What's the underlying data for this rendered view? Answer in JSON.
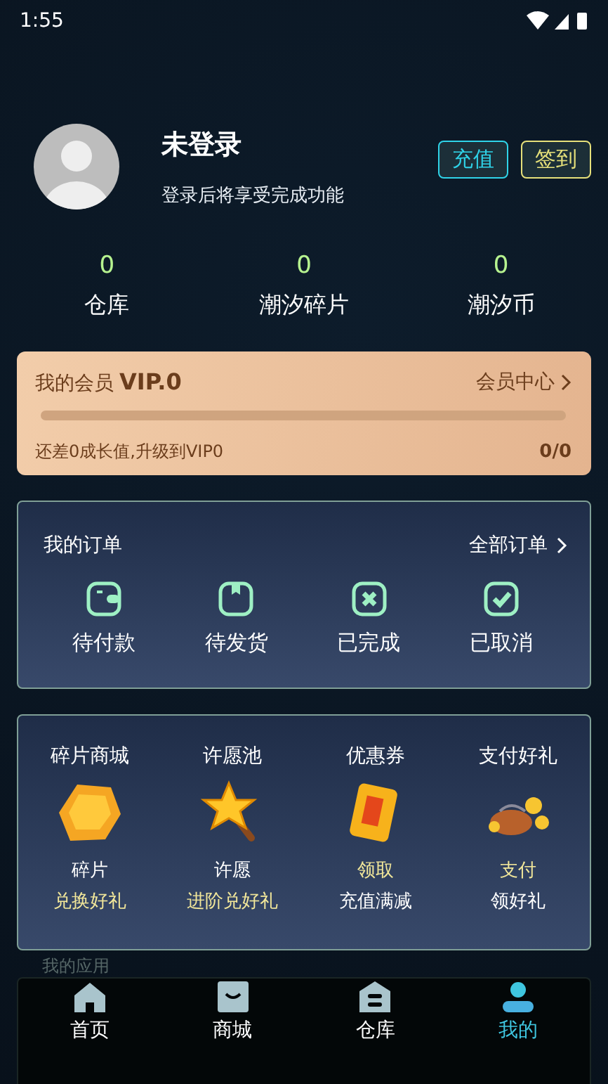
{
  "status_bar": {
    "time": "1:55"
  },
  "profile": {
    "name": "未登录",
    "subtitle": "登录后将享受完成功能",
    "buttons": [
      {
        "label": "充值",
        "kind": "recharge"
      },
      {
        "label": "签到",
        "kind": "checkin"
      }
    ]
  },
  "stats": [
    {
      "value": "0",
      "label": "仓库"
    },
    {
      "value": "0",
      "label": "潮汐碎片"
    },
    {
      "value": "0",
      "label": "潮汐币"
    }
  ],
  "vip": {
    "title": "我的会员",
    "level_name": "VIP.0",
    "link": "会员中心",
    "level": 0,
    "hint": "还差0成长值,升级到VIP0",
    "progress": "0/0"
  },
  "orders": {
    "title": "我的订单",
    "link": "全部订单",
    "items": [
      {
        "label": "待付款",
        "kind": "wallet"
      },
      {
        "label": "待发货",
        "kind": "box"
      },
      {
        "label": "已完成",
        "kind": "cross"
      },
      {
        "label": "已取消",
        "kind": "check"
      }
    ]
  },
  "benefits": [
    {
      "title": "碎片商城",
      "kind": "gem",
      "lines": [
        {
          "text": "碎片",
          "highlight": false
        },
        {
          "text": "兑换好礼",
          "highlight": true
        }
      ]
    },
    {
      "title": "许愿池",
      "kind": "wand",
      "lines": [
        {
          "text": "许愿",
          "highlight": false
        },
        {
          "text": "进阶兑好礼",
          "highlight": true
        }
      ]
    },
    {
      "title": "优惠券",
      "kind": "coupon",
      "lines": [
        {
          "text": "领取",
          "highlight": true
        },
        {
          "text": "充值满减",
          "highlight": false
        }
      ]
    },
    {
      "title": "支付好礼",
      "kind": "bag",
      "lines": [
        {
          "text": "支付",
          "highlight": true
        },
        {
          "text": "领好礼",
          "highlight": false
        }
      ]
    }
  ],
  "section_label": "我的应用",
  "tabs": [
    {
      "label": "首页",
      "kind": "home",
      "selected": false
    },
    {
      "label": "商城",
      "kind": "shop",
      "selected": false
    },
    {
      "label": "仓库",
      "kind": "warehouse",
      "selected": false
    },
    {
      "label": "我的",
      "kind": "me",
      "selected": true
    }
  ]
}
